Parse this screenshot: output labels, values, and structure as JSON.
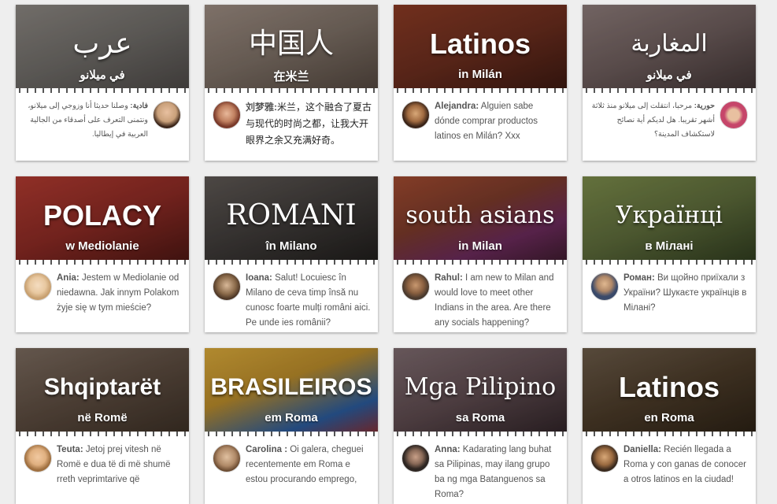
{
  "cards": [
    {
      "title": "عرب",
      "subtitle": "في ميلانو",
      "author": "فادية:",
      "message": " وصلنا حديثا أنا وزوجي إلى ميلانو، ونتمنى التعرف على أصدقاء من الجالية العربية في إيطاليا."
    },
    {
      "title": "中国人",
      "subtitle": "在米兰",
      "author": "刘梦雅:",
      "message": "米兰，这个融合了夏古与现代的时尚之都，让我大开眼界之余又充满好奇。"
    },
    {
      "title": "Latinos",
      "subtitle": "in Milán",
      "author": "Alejandra:",
      "message": " Alguien sabe dónde comprar productos latinos en Milán? Xxx"
    },
    {
      "title": "المغاربة",
      "subtitle": "في ميلانو",
      "author": "حورية:",
      "message": " مرحبا، انتقلت إلى ميلانو منذ ثلاثة أشهر تقريبا. هل لديكم أية نصائح لاستكشاف المدينة؟"
    },
    {
      "title": "POLACY",
      "subtitle": "w Mediolanie",
      "author": "Ania:",
      "message": " Jestem w Mediolanie od niedawna. Jak innym Polakom żyje się w tym mieście?"
    },
    {
      "title": "ROMANI",
      "subtitle": "în Milano",
      "author": "Ioana:",
      "message": " Salut! Locuiesc în Milano de ceva timp însă nu cunosc foarte mulți români aici. Pe unde ies românii?"
    },
    {
      "title": "south asians",
      "subtitle": "in Milan",
      "author": "Rahul:",
      "message": " I am new to Milan and would love to meet other Indians in the area. Are there any socials happening?"
    },
    {
      "title": "Українці",
      "subtitle": "в Мілані",
      "author": "Роман:",
      "message": " Ви щойно приїхали з України? Шукаєте українців в Мілані?"
    },
    {
      "title": "Shqiptarët",
      "subtitle": "në Romë",
      "author": "Teuta:",
      "message": " Jetoj prej vitesh në Romë e dua të di më shumë rreth veprimtarive që"
    },
    {
      "title": "BRASILEIROS",
      "subtitle": "em Roma",
      "author": "Carolina :",
      "message": " Oi galera, cheguei recentemente em Roma e estou procurando emprego,"
    },
    {
      "title": "Mga Pilipino",
      "subtitle": "sa Roma",
      "author": "Anna:",
      "message": " Kadarating lang buhat sa Pilipinas, may ilang grupo ba ng mga Batanguenos sa Roma?"
    },
    {
      "title": "Latinos",
      "subtitle": "en Roma",
      "author": "Daniella:",
      "message": " Recién llegada a Roma y con ganas de conocer a otros latinos en la ciudad!"
    }
  ],
  "colors": {
    "banner_1": "#6d6a66",
    "banner_2": "#7a6d63",
    "banner_3": "#6a2d1e",
    "banner_4": "#6b5b5a",
    "banner_5": "#8a2a24",
    "banner_6": "#3e3a38",
    "banner_7": "#7a3a2a",
    "banner_8": "#5c6a3a",
    "banner_9": "#5a4a3e",
    "banner_10": "#b88a2a",
    "banner_11": "#5d4a4e",
    "banner_12": "#4a3a28",
    "avatar_1": "#c9a07a",
    "avatar_2": "#7a3a2a",
    "avatar_3": "#3a2418",
    "avatar_4": "#c6466a",
    "avatar_5": "#e8c8a0",
    "avatar_6": "#8a6a4a",
    "avatar_7": "#4a3a2e",
    "avatar_8": "#3a4a6a",
    "avatar_9": "#e0b080",
    "avatar_10": "#b08a68",
    "avatar_11": "#2e2622",
    "avatar_12": "#3a2a1e"
  }
}
